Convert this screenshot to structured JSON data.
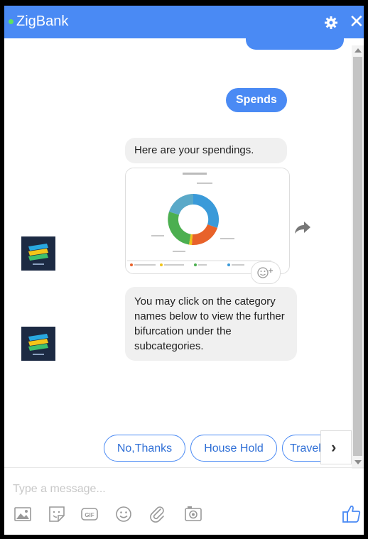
{
  "header": {
    "title": "ZigBank",
    "close_glyph": "✕"
  },
  "messages": {
    "user_spends": "Spends",
    "bot_spendings": "Here are your spendings.",
    "bot_instruction": "You may click on the category names below to view the further bifurcation under the subcategories."
  },
  "quick_replies": [
    "No,Thanks",
    "House Hold",
    "Travel"
  ],
  "quick_reply_next": "›",
  "composer": {
    "placeholder": "Type a message..."
  },
  "icons": [
    "image-icon",
    "sticker-icon",
    "gif-icon",
    "emoji-icon",
    "attachment-icon",
    "camera-icon",
    "thumbs-up-icon",
    "gear-icon",
    "close-icon",
    "share-icon",
    "reaction-emoji-icon"
  ],
  "colors": {
    "brand": "#4a8af4",
    "bot_bubble": "#f0f0f0",
    "avatar_bg": "#1c2a43"
  }
}
